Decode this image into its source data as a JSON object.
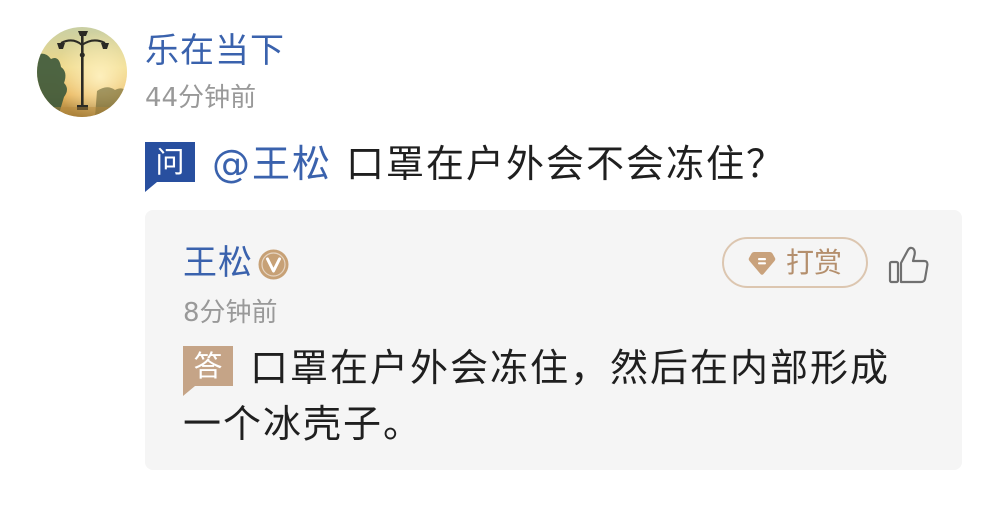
{
  "post": {
    "avatar_icon": "avatar-image",
    "author_name": "乐在当下",
    "time": "44分钟前",
    "question": {
      "badge": "问",
      "mention": "@王松",
      "text": "口罩在户外会不会冻住？"
    }
  },
  "answer": {
    "author_name": "王松",
    "verified_icon": "verified-v-icon",
    "tip_button": {
      "icon": "diamond-icon",
      "label": "打赏"
    },
    "like_icon": "thumbs-up-icon",
    "time": "8分钟前",
    "badge": "答",
    "text": "口罩在户外会冻住，然后在内部形成一个冰壳子。"
  },
  "colors": {
    "link_blue": "#3a62ad",
    "question_badge": "#284f9f",
    "answer_badge": "#c5a487",
    "tip_accent": "#b48f6d",
    "tip_border": "#dcc6b0",
    "verified_badge": "#c7a176",
    "card_bg": "#f5f5f5",
    "timestamp_gray": "#999999",
    "text": "#1f1f1f",
    "icon_gray": "#707070"
  }
}
